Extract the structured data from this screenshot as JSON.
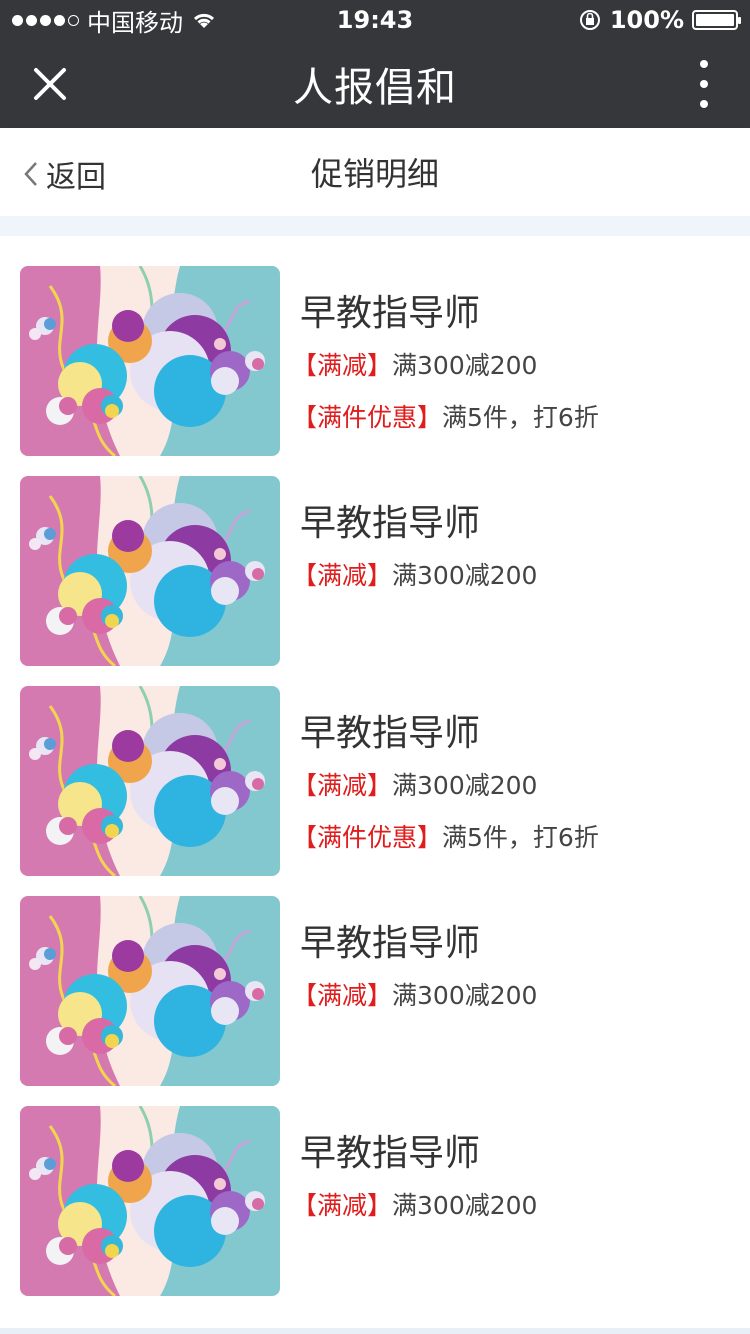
{
  "status_bar": {
    "carrier": "中国移动",
    "time": "19:43",
    "battery": "100%"
  },
  "header": {
    "title": "人报倡和",
    "close_icon": "close-icon",
    "more_icon": "more-vertical-icon"
  },
  "subheader": {
    "back_label": "返回",
    "title": "促销明细"
  },
  "items": [
    {
      "title": "早教指导师",
      "promos": [
        {
          "tag": "【满减】",
          "text": "满300减200"
        },
        {
          "tag": "【满件优惠】",
          "text": "满5件，打6折"
        }
      ]
    },
    {
      "title": "早教指导师",
      "promos": [
        {
          "tag": "【满减】",
          "text": "满300减200"
        }
      ]
    },
    {
      "title": "早教指导师",
      "promos": [
        {
          "tag": "【满减】",
          "text": "满300减200"
        },
        {
          "tag": "【满件优惠】",
          "text": "满5件，打6折"
        }
      ]
    },
    {
      "title": "早教指导师",
      "promos": [
        {
          "tag": "【满减】",
          "text": "满300减200"
        }
      ]
    },
    {
      "title": "早教指导师",
      "promos": [
        {
          "tag": "【满减】",
          "text": "满300减200"
        }
      ]
    }
  ],
  "colors": {
    "header_bg": "#36373a",
    "promo_tag": "#e01c1c",
    "band": "#f0f5fb"
  }
}
